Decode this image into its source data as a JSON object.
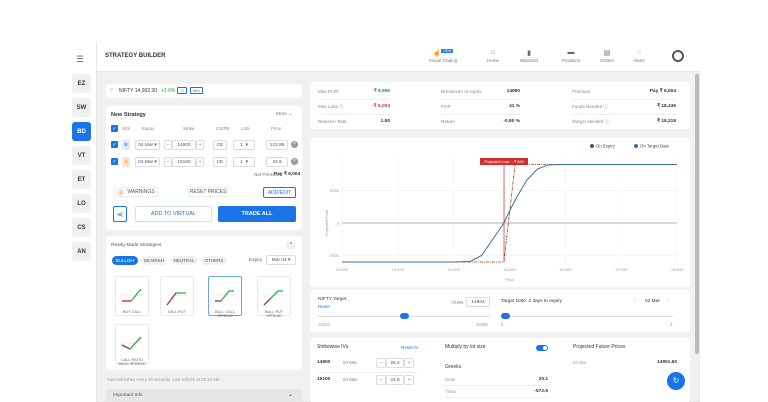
{
  "header": {
    "title": "STRATEGY BUILDER",
    "nav": [
      {
        "label": "Social Trading",
        "icon": "social-icon",
        "badge": "NEW"
      },
      {
        "label": "Home",
        "icon": "home-icon"
      },
      {
        "label": "Watchlist",
        "icon": "bookmark-icon"
      },
      {
        "label": "Positions",
        "icon": "briefcase-icon"
      },
      {
        "label": "Orders",
        "icon": "orders-icon"
      },
      {
        "label": "Alerts",
        "icon": "whatsapp-icon"
      }
    ]
  },
  "sidebar": {
    "items": [
      "EZ",
      "SW",
      "BD",
      "VT",
      "ET",
      "LO",
      "CS",
      "AN"
    ],
    "active": "BD"
  },
  "search": {
    "symbol": "NIFTY 14,902.30",
    "change": "+1.0%",
    "info": "Info"
  },
  "strategy": {
    "title": "New Strategy",
    "more": "More",
    "columns": [
      "B/S",
      "Expiry",
      "Strike",
      "CE/PE",
      "Lots",
      "Price"
    ],
    "legs": [
      {
        "side": "B",
        "expiry": "04 Mar",
        "strike": "14900",
        "type": "CE",
        "lots": "1",
        "price": "122.95"
      },
      {
        "side": "S",
        "expiry": "04 Mar",
        "strike": "15100",
        "type": "CE",
        "lots": "1",
        "price": "42.9"
      }
    ],
    "net_premium_label": "Net Premium:",
    "net_premium": "Pay ₹ 6,004",
    "warnings_count": "2",
    "warnings": "WARNINGS",
    "reset_prices": "RESET PRICES",
    "add_edit": "ADD/EDIT",
    "add_virtual": "ADD TO VIRTUAL",
    "trade_all": "TRADE ALL"
  },
  "readymade": {
    "title": "Ready-Made Strategies",
    "tabs": [
      "BULLISH",
      "BEARISH",
      "NEUTRAL",
      "OTHERS"
    ],
    "active_tab": "BULLISH",
    "expiry_label": "Expiry",
    "expiry": "Mar 04",
    "items": [
      "BUY CALL",
      "SELL PUT",
      "BULL CALL SPREAD",
      "BULL PUT SPREAD",
      "CALL RATIO BACK SPREAD"
    ],
    "selected": "BULL CALL SPREAD"
  },
  "refresh_note": "Auto-refreshes every 30 seconds. Last refresh at 09:32 AM",
  "important_info": "Important Info",
  "stats": [
    [
      {
        "label": "Max Profit",
        "value": "₹ 8,996",
        "color": "#1e9e3a"
      },
      {
        "label": "Breakeven at expiry",
        "value": "14980"
      },
      {
        "label": "Premium",
        "value": "Pay ₹ 6,004"
      }
    ],
    [
      {
        "label": "Max Loss",
        "value": "-₹ 6,004",
        "color": "#d32f2f"
      },
      {
        "label": "POP",
        "value": "41 %"
      },
      {
        "label": "Funds Needed",
        "value": "₹ 18,436"
      }
    ],
    [
      {
        "label": "Reward / Risk",
        "value": "1.50"
      },
      {
        "label": "Return",
        "value": "-0.80 %"
      },
      {
        "label": "Margin Needed",
        "value": "₹ 15,218"
      }
    ]
  ],
  "chart_data": {
    "type": "line",
    "xlabel": "Price",
    "ylabel": "Projected Profit",
    "xlim": [
      12000,
      18000
    ],
    "ylim": [
      -6600,
      10500
    ],
    "x_ticks": [
      "12,000",
      "13,000",
      "14,000",
      "15,000",
      "16,000",
      "17,000",
      "18,000"
    ],
    "y_ticks": [
      "5000",
      "0",
      "-5000"
    ],
    "grid": true,
    "legend": "top-right",
    "series": [
      {
        "name": "On Expiry",
        "color": "#8b4513",
        "x": [
          12000,
          14900,
          15100,
          18000
        ],
        "y": [
          -6004,
          -6004,
          8996,
          8996
        ]
      },
      {
        "name": "On Target Date",
        "color": "#3b6fa0",
        "x": [
          12000,
          14000,
          14300,
          14500,
          14700,
          14900,
          15000,
          15100,
          15300,
          15500,
          15700,
          16000,
          18000
        ],
        "y": [
          -6004,
          -6004,
          -5900,
          -5000,
          -2500,
          0,
          1800,
          3500,
          6500,
          8300,
          8950,
          8996,
          8996
        ]
      }
    ],
    "marker": {
      "x": 14902,
      "label": "Projected Loss : -₹ 642"
    }
  },
  "target": {
    "label": "NIFTY Target",
    "reset": "Reset",
    "change": "+0.0%",
    "value": "14904",
    "min": "13410",
    "max": "16390",
    "fraction": 0.5,
    "date_label": "Target Date: 2 days to expiry",
    "date": "02 Mar",
    "date_min": "0",
    "date_max": "2",
    "date_fraction": 0
  },
  "ivs": {
    "title": "Strikewise IVs",
    "reset": "Reset IV",
    "rows": [
      {
        "strike": "14900",
        "expiry": "04 Mar",
        "iv": "26.2"
      },
      {
        "strike": "15100",
        "expiry": "04 Mar",
        "iv": "24.6"
      }
    ]
  },
  "greeks": {
    "multiply": "Multiply by lot size",
    "multiply_on": true,
    "title": "Greeks",
    "rows": [
      {
        "label": "Delta",
        "value": "20.1"
      },
      {
        "label": "Theta",
        "value": "-572.6"
      }
    ]
  },
  "futures": {
    "title": "Projected Future Prices",
    "rows": [
      {
        "expiry": "04 Mar",
        "value": "14901.60"
      }
    ]
  }
}
